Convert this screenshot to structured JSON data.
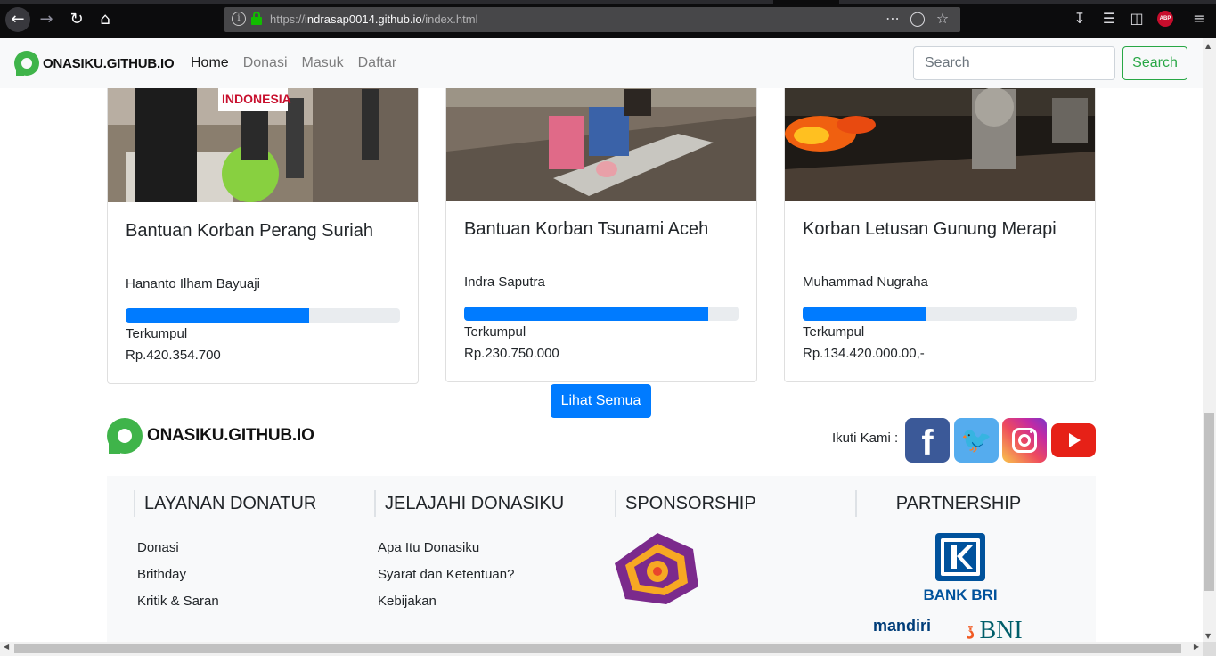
{
  "browser": {
    "url_prefix": "https://",
    "url_host": "indrasap0014.github.io",
    "url_path": "/index.html",
    "abp_label": "ABP"
  },
  "navbar": {
    "brand": "ONASIKU.GITHUB.IO",
    "links": [
      "Home",
      "Donasi",
      "Masuk",
      "Daftar"
    ],
    "search_placeholder": "Search",
    "search_button": "Search"
  },
  "cards": [
    {
      "title": "Bantuan Korban Perang Suriah",
      "author": "Hananto Ilham Bayuaji",
      "progress_fraction": 0.67,
      "collected_label": "Terkumpul",
      "amount": "Rp.420.354.700",
      "image_caption": "INDONESIA"
    },
    {
      "title": "Bantuan Korban Tsunami Aceh",
      "author": "Indra Saputra",
      "progress_fraction": 0.89,
      "collected_label": "Terkumpul",
      "amount": "Rp.230.750.000"
    },
    {
      "title": "Korban Letusan Gunung Merapi",
      "author": "Muhammad Nugraha",
      "progress_fraction": 0.45,
      "collected_label": "Terkumpul",
      "amount": "Rp.134.420.000.00,-"
    }
  ],
  "see_all_button": "Lihat Semua",
  "footer": {
    "brand": "ONASIKU.GITHUB.IO",
    "follow_label": "Ikuti Kami :",
    "social": [
      "facebook",
      "twitter",
      "instagram",
      "youtube"
    ],
    "columns": [
      {
        "heading": "LAYANAN DONATUR",
        "items": [
          "Donasi",
          "Brithday",
          "Kritik & Saran"
        ]
      },
      {
        "heading": "JELAJAHI DONASIKU",
        "items": [
          "Apa Itu Donasiku",
          "Syarat dan Ketentuan?",
          "Kebijakan"
        ]
      },
      {
        "heading": "SPONSORSHIP",
        "items": []
      }
    ],
    "partnership_heading": "PARTNERSHIP",
    "partners": [
      "BANK BRI",
      "mandiri",
      "BNI"
    ]
  },
  "colors": {
    "primary": "#007bff",
    "success": "#28a745",
    "brand_green": "#3fb44a",
    "navbar_bg": "#f8f9fa"
  }
}
